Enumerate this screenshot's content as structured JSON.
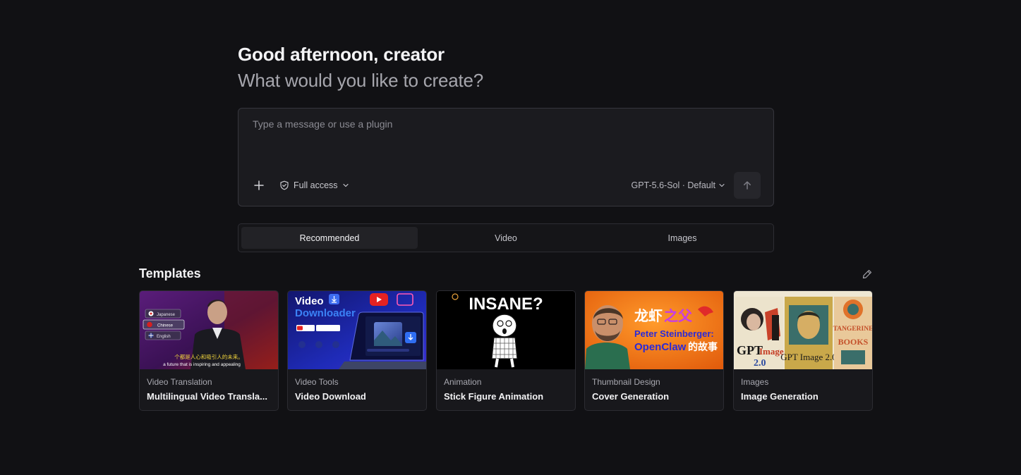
{
  "header": {
    "greeting": "Good afternoon, creator",
    "subgreeting": "What would you like to create?"
  },
  "composer": {
    "placeholder": "Type a message or use a plugin",
    "access_label": "Full access",
    "model_label": "GPT-5.6-Sol · Default"
  },
  "tabs": [
    {
      "label": "Recommended",
      "active": true
    },
    {
      "label": "Video",
      "active": false
    },
    {
      "label": "Images",
      "active": false
    }
  ],
  "templates": {
    "title": "Templates",
    "cards": [
      {
        "category": "Video Translation",
        "title": "Multilingual Video Transla...",
        "thumb": {
          "languages": [
            "Japanese",
            "Chinese",
            "English"
          ],
          "subtitle_cn": "个都是人心和吸引人的未来。",
          "subtitle_en": "a future that is inspiring and appealing"
        }
      },
      {
        "category": "Video Tools",
        "title": "Video Download",
        "thumb": {
          "heading1": "Video",
          "heading2": "Downloader"
        }
      },
      {
        "category": "Animation",
        "title": "Stick Figure Animation",
        "thumb": {
          "heading": "INSANE?"
        }
      },
      {
        "category": "Thumbnail Design",
        "title": "Cover Generation",
        "thumb": {
          "line1a": "龙虾",
          "line1b": "之父",
          "line2": "Peter Steinberger:",
          "line3a": "OpenClaw",
          "line3b": "的故事"
        }
      },
      {
        "category": "Images",
        "title": "Image Generation",
        "thumb": {
          "poster1a": "GPT",
          "poster1b": "Image",
          "poster1c": "2.0",
          "poster2": "GPT Image 2.0",
          "poster3a": "TANGERINE",
          "poster3b": "BOOKS"
        }
      }
    ]
  },
  "colors": {
    "background": "#111114",
    "composer_bg": "#1b1b1f",
    "card_bg": "#18181c",
    "thumb_orange": "#f27a12",
    "thumb_blue": "#1f2bb8"
  }
}
